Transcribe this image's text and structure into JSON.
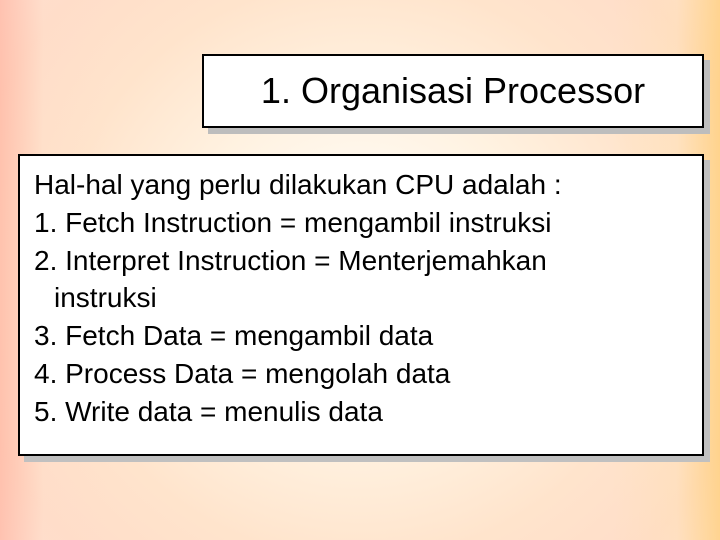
{
  "title": "1. Organisasi Processor",
  "body": {
    "intro": "Hal-hal yang perlu dilakukan CPU adalah :",
    "items": [
      "1. Fetch Instruction = mengambil instruksi",
      "2. Interpret Instruction = Menterjemahkan",
      "instruksi",
      "3. Fetch Data = mengambil data",
      "4. Process Data = mengolah data",
      "5. Write data = menulis data"
    ]
  }
}
